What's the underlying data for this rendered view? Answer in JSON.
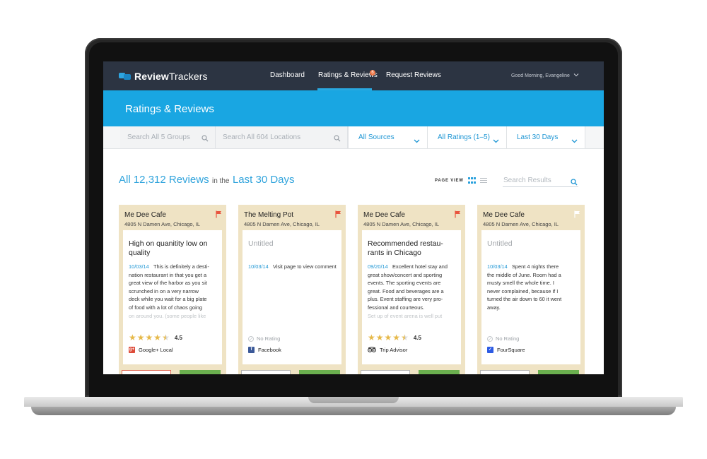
{
  "app": {
    "logo_bold": "Review",
    "logo_light": "Trackers"
  },
  "nav": {
    "items": [
      "Dashboard",
      "Ratings & Reviews",
      "Request Reviews"
    ],
    "active": "Ratings & Reviews",
    "badge": "6",
    "greeting": "Good Morning, Evangeline"
  },
  "banner": {
    "title": "Ratings & Reviews"
  },
  "filters": {
    "group_search_placeholder": "Search All 5 Groups",
    "location_search_placeholder": "Search All 604 Locations",
    "sources": "All Sources",
    "ratings": "All Ratings (1–5)",
    "period": "Last 30 Days"
  },
  "heading": {
    "count": "All 12,312 Reviews",
    "connector": "in the",
    "period": "Last 30 Days"
  },
  "view": {
    "label": "PAGE VIEW",
    "mode": "grid",
    "search_placeholder": "Search Results"
  },
  "colors": {
    "nav_bg": "#2c3442",
    "accent": "#19a6e2",
    "card_bg": "#efe3c4",
    "star": "#e6b94a",
    "flag_red": "#e8553f",
    "action_green": "#6bb04f"
  },
  "cards": [
    {
      "name": "Me Dee Cafe",
      "address": "4805 N Damen Ave, Chicago, IL",
      "flagged": true,
      "title": "High on quanitity low on quality",
      "date": "10/03/14",
      "body_lines": [
        "This is definitely a desti-",
        "nation restaurant in that you get a",
        "great view of the harbor as you sit",
        "scrunched in on a very narrow",
        "deck while you wait for a big plate",
        "of food with a lot of chaos going"
      ],
      "fade_line": "on around you. (some people like",
      "rating": 4.5,
      "rating_text": "4.5",
      "source": "Google+ Local",
      "source_icon": "google-plus-icon",
      "source_color": "#dd4b39"
    },
    {
      "name": "The Melting Pot",
      "address": "4805 N Damen Ave, Chicago, IL",
      "flagged": true,
      "title": "Untitled",
      "date": "10/03/14",
      "body_lines": [
        "Visit page to view comment"
      ],
      "fade_line": "",
      "rating": null,
      "rating_text": "No Rating",
      "source": "Facebook",
      "source_icon": "facebook-icon",
      "source_color": "#3b5998"
    },
    {
      "name": "Me Dee Cafe",
      "address": "4805 N Damen Ave, Chicago, IL",
      "flagged": true,
      "title": "Recommended restau-rants in Chicago",
      "date": "09/20/14",
      "body_lines": [
        "Excellent hotel stay and",
        "great show/concert and sporting",
        "events. The sporting events are",
        "great. Food and beverages are a",
        "plus. Event staffing are very pro-",
        "fessional and courteous."
      ],
      "fade_line": "Set up of event arena is well put",
      "rating": 4.5,
      "rating_text": "4.5",
      "source": "Trip Advisor",
      "source_icon": "tripadvisor-icon",
      "source_color": "#222222"
    },
    {
      "name": "Me Dee Cafe",
      "address": "4805 N Damen Ave, Chicago, IL",
      "flagged": false,
      "title": "Untitled",
      "date": "10/03/14",
      "body_lines": [
        "Spent 4 nights there",
        "the middle of June. Room had a",
        "musty smell the whole time. I",
        "never complained, because if I",
        "turned the air down to 60 it went",
        "away."
      ],
      "fade_line": "",
      "rating": null,
      "rating_text": "No Rating",
      "source": "FourSquare",
      "source_icon": "foursquare-icon",
      "source_color": "#2d5be3"
    }
  ]
}
